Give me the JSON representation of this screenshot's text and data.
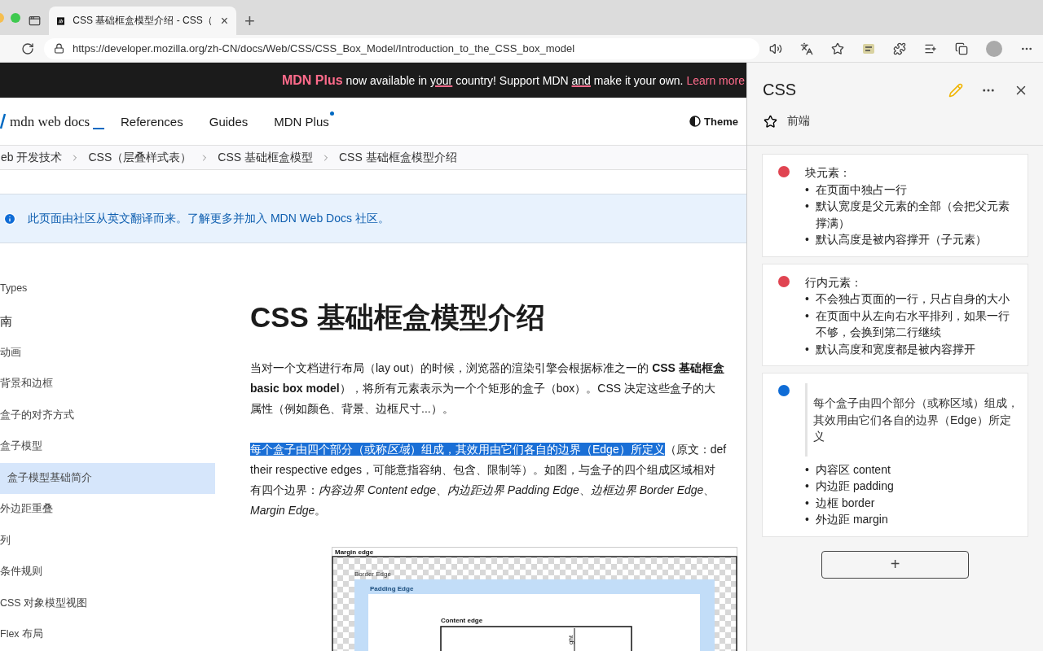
{
  "browser": {
    "tab": {
      "title": "CSS 基础框盒模型介绍 - CSS（",
      "close": "×"
    },
    "new_tab": "+",
    "url": "https://developer.mozilla.org/zh-CN/docs/Web/CSS/CSS_Box_Model/Introduction_to_the_CSS_box_model"
  },
  "banner": {
    "segments": [
      {
        "text": "MDN Plus",
        "kind": "brand"
      },
      {
        "text": " now available in ",
        "kind": "plain"
      },
      {
        "text": "your",
        "kind": "underline"
      },
      {
        "text": " country! Support MDN ",
        "kind": "plain"
      },
      {
        "text": "and",
        "kind": "underline"
      },
      {
        "text": " make it your own. ",
        "kind": "plain"
      },
      {
        "text": "Learn more",
        "kind": "link"
      }
    ]
  },
  "header": {
    "logo": "mdn web docs",
    "nav": [
      {
        "label": "References",
        "badge": false
      },
      {
        "label": "Guides",
        "badge": false
      },
      {
        "label": "MDN Plus",
        "badge": true
      }
    ],
    "theme": "Theme"
  },
  "breadcrumbs": [
    "eb 开发技术",
    "CSS（层叠样式表）",
    "CSS 基础框盒模型",
    "CSS 基础框盒模型介绍"
  ],
  "notice": "此页面由社区从英文翻译而来。了解更多并加入 MDN Web Docs 社区。",
  "sidebar": {
    "items": [
      {
        "label": "Types",
        "kind": "item",
        "selected": false
      },
      {
        "label": "南",
        "kind": "heading",
        "selected": false
      },
      {
        "label": "动画",
        "kind": "item",
        "selected": false
      },
      {
        "label": "背景和边框",
        "kind": "item",
        "selected": false
      },
      {
        "label": "盒子的对齐方式",
        "kind": "item",
        "selected": false
      },
      {
        "label": "盒子模型",
        "kind": "item",
        "selected": false
      },
      {
        "label": "盒子模型基础简介",
        "kind": "child",
        "selected": true
      },
      {
        "label": "外边距重叠",
        "kind": "item",
        "selected": false
      },
      {
        "label": "列",
        "kind": "item",
        "selected": false
      },
      {
        "label": "条件规则",
        "kind": "item",
        "selected": false
      },
      {
        "label": "CSS 对象模型视图",
        "kind": "item",
        "selected": false
      },
      {
        "label": "Flex 布局",
        "kind": "item",
        "selected": false
      }
    ]
  },
  "article": {
    "title": "CSS 基础框盒模型介绍",
    "paragraphs": [
      {
        "lines": [
          "当对一个文档进行布局（lay out）的时候，浏览器的渲染引擎会根据标准之一的 **CSS 基础框盒**",
          "**basic box model**），将所有元素表示为一个个矩形的盒子（box）。CSS 决定这些盒子的大",
          "属性（例如颜色、背景、边框尺寸...）。"
        ]
      },
      {
        "lines": [
          [
            {
              "text": "每个盒子由四个部分（或称",
              "highlight": true,
              "italic": false
            },
            {
              "text": "区域",
              "highlight": true,
              "italic": true
            },
            {
              "text": "）组成，其效用由它们各自的边界（Edge）所定义",
              "highlight": true,
              "italic": false
            },
            {
              "text": "（原文：def",
              "highlight": false,
              "italic": false
            }
          ],
          "their respective edges，可能意指容纳、包含、限制等）。如图，与盒子的四个组成区域相对",
          "有四个边界：*内容边界 Content edge*、*内边距边界 Padding Edge*、*边框边界 Border Edge*、",
          "*Margin Edge*。"
        ]
      }
    ],
    "figure": {
      "margin": "Margin edge",
      "border": "Border Edge",
      "padding": "Padding Edge",
      "content": "Content edge",
      "height": "ght"
    }
  },
  "panel": {
    "title": "CSS",
    "tag": "前端",
    "notes": [
      {
        "color": "#e04451",
        "title": "块元素：",
        "bullets": [
          "在页面中独占一行",
          "默认宽度是父元素的全部（会把父元素撑满）",
          "默认高度是被内容撑开（子元素）"
        ]
      },
      {
        "color": "#e04451",
        "title": "行内元素：",
        "bullets": [
          "不会独占页面的一行，只占自身的大小",
          "在页面中从左向右水平排列，如果一行不够，会换到第二行继续",
          "默认高度和宽度都是被内容撑开"
        ]
      },
      {
        "color": "#0f6cd6",
        "quote": "每个盒子由四个部分（或称区域）组成，其效用由它们各自的边界（Edge）所定义",
        "bullets": [
          "内容区 content",
          "内边距 padding",
          "边框 border",
          "外边距 margin"
        ]
      }
    ],
    "marker": "•",
    "add": "+"
  }
}
